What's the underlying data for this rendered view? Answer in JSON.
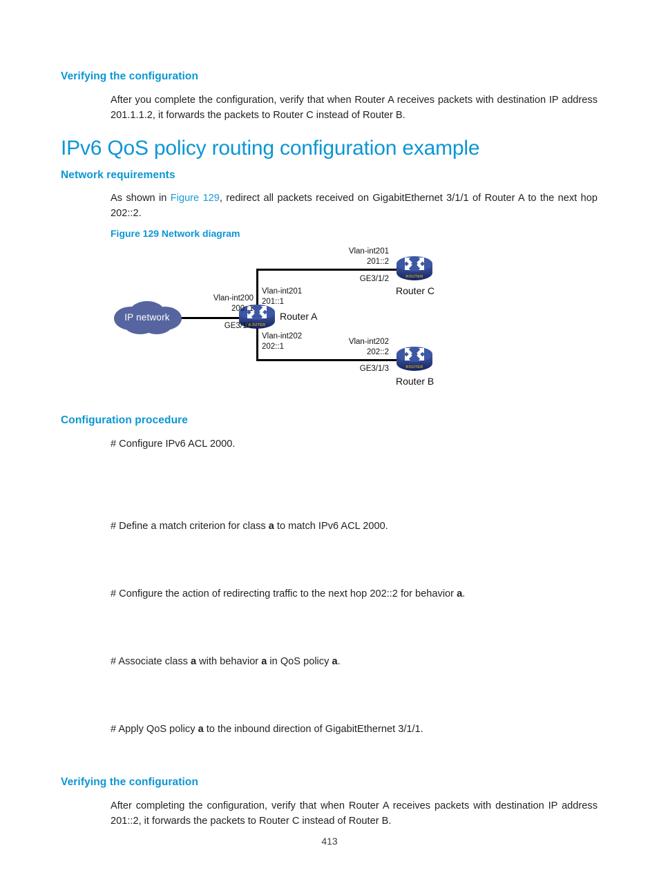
{
  "document": {
    "page_number": "413",
    "accent_color": "#0b96d4",
    "link_color": "#1b9ad6",
    "body_color": "#231f20"
  },
  "sections": {
    "verify_top": {
      "heading": "Verifying the configuration",
      "paragraph_pre": "After you complete the configuration, verify that when Router A receives packets with destination IP address 201.1.1.2, it forwards the packets to Router C instead of Router B."
    },
    "title": "IPv6 QoS policy routing configuration example",
    "network_requirements": {
      "heading": "Network requirements",
      "text_before_link": "As shown in ",
      "link_text": "Figure 129",
      "text_after_link": ", redirect all packets received on GigabitEthernet 3/1/1 of Router A to the next hop 202::2."
    },
    "figure": {
      "caption": "Figure 129 Network diagram"
    },
    "configuration_procedure": {
      "heading": "Configuration procedure",
      "steps": [
        "# Configure IPv6 ACL 2000.",
        "# Define a match criterion for class ",
        "# Configure the action of redirecting traffic to the next hop 202::2 for behavior ",
        "# Associate class ",
        "# Apply QoS policy "
      ],
      "step1": "# Configure IPv6 ACL 2000.",
      "step2_a": "# Define a match criterion for class ",
      "step2_b": "a",
      "step2_c": " to match IPv6 ACL 2000.",
      "step3_a": "# Configure the action of redirecting traffic to the next hop 202::2 for behavior ",
      "step3_b": "a",
      "step3_c": ".",
      "step4_a": "# Associate class ",
      "step4_b": "a",
      "step4_c": " with behavior ",
      "step4_d": "a",
      "step4_e": " in QoS policy ",
      "step4_f": "a",
      "step4_g": ".",
      "step5_a": "# Apply QoS policy ",
      "step5_b": "a",
      "step5_c": " to the inbound direction of GigabitEthernet 3/1/1."
    },
    "verify_bottom": {
      "heading": "Verifying the configuration",
      "paragraph": "After completing the configuration, verify that when Router A receives packets with destination IP address 201::2, it forwards the packets to Router C instead of Router B."
    }
  },
  "diagram": {
    "cloud": {
      "label": "IP network",
      "fill": "#56659f"
    },
    "router_fill_top": "#3f5aa8",
    "router_fill_body": "#1e2f73",
    "nodes": [
      {
        "name": "Router A"
      },
      {
        "name": "Router C"
      },
      {
        "name": "Router B"
      }
    ],
    "router_a": {
      "name": "Router A",
      "left_iface": "Vlan-int200",
      "left_addr": "200::1",
      "left_port": "GE3/1/1",
      "top_iface": "Vlan-int201",
      "top_addr": "201::1",
      "bottom_iface": "Vlan-int202",
      "bottom_addr": "202::1"
    },
    "router_c": {
      "name": "Router C",
      "iface": "Vlan-int201",
      "addr": "201::2",
      "port": "GE3/1/2"
    },
    "router_b": {
      "name": "Router B",
      "iface": "Vlan-int202",
      "addr": "202::2",
      "port": "GE3/1/3"
    },
    "icon_caption": "ROUTER"
  }
}
